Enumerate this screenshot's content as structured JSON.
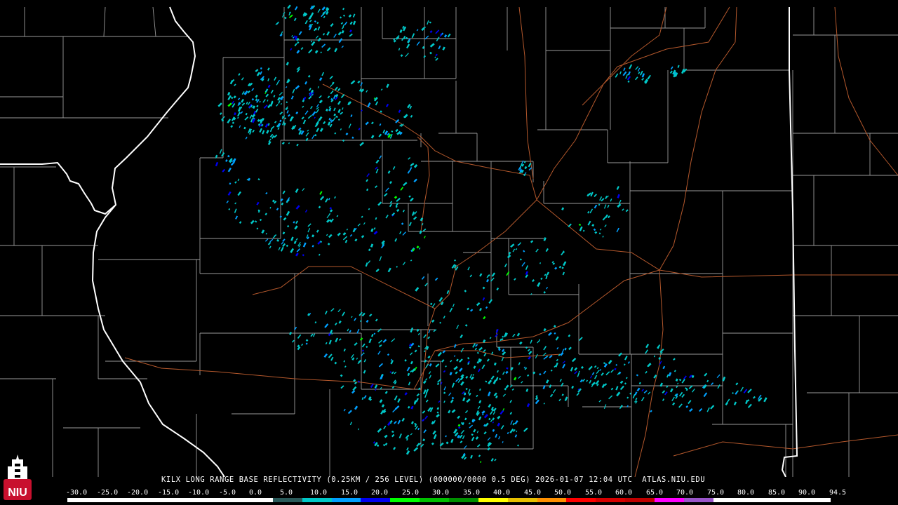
{
  "product": {
    "title": "KILX LONG RANGE BASE REFLECTIVITY (0.25KM / 256 LEVEL) (000000/0000 0.5 DEG) 2026-01-07 12:04 UTC  ATLAS.NIU.EDU"
  },
  "logo": {
    "text": "NIU",
    "colors": {
      "red": "#c8102e",
      "white": "#ffffff"
    }
  },
  "colors": {
    "background": "#000000",
    "county_border": "#a0a0a0",
    "state_border": "#ffffff",
    "highway": "#b4582c"
  },
  "legend": {
    "labels": [
      "-30.0",
      "-25.0",
      "-20.0",
      "-15.0",
      "-10.0",
      "-5.0",
      "0.0",
      "5.0",
      "10.0",
      "15.0",
      "20.0",
      "25.0",
      "30.0",
      "35.0",
      "40.0",
      "45.0",
      "50.0",
      "55.0",
      "60.0",
      "65.0",
      "70.0",
      "75.0",
      "80.0",
      "85.0",
      "90.0",
      "94.5"
    ],
    "colors": [
      "#ffffff",
      "#ffffff",
      "#ffffff",
      "#ffffff",
      "#ffffff",
      "#ffffff",
      "#ffffff",
      "#2a5a5a",
      "#00c8c8",
      "#00a0ff",
      "#0000f0",
      "#00ff00",
      "#00c000",
      "#009000",
      "#ffff00",
      "#e7c000",
      "#ff9000",
      "#ff0000",
      "#d60000",
      "#c00000",
      "#ff00ff",
      "#9955c9",
      "#ffffff",
      "#ffffff",
      "#ffffff",
      "#ffffff"
    ]
  },
  "echo_colors": [
    "#00c8c8",
    "#00a0ff",
    "#0000f0",
    "#00ff00"
  ]
}
